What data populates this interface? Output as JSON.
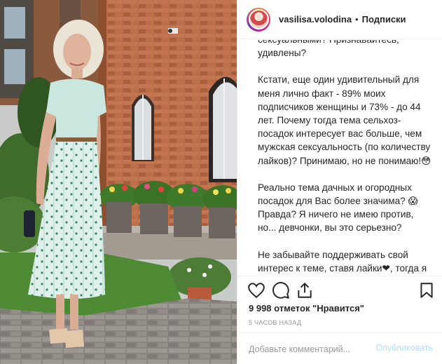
{
  "header": {
    "username": "vasilisa.volodina",
    "separator": "•",
    "follow_label": "Подписки"
  },
  "caption": {
    "lines_top": [
      "сексуальными? Признавайтесь,",
      "удивлены?"
    ],
    "paragraph_2": "Кстати, еще один удивительный для меня лично факт - 89% моих подписчиков женщины и 73% - до 44 лет. Почему тогда тема сельхоз-посадок интересует вас больше, чем мужская сексуальность (по количеству лайков)? Принимаю, но не понимаю!😳",
    "paragraph_3": "Реально тема дачных и огородных посадок для Вас более значима? 😱 Правда? Я ничего не имею против, но... девчонки, вы это серьезно?",
    "paragraph_4": "Не забывайте поддерживать свой интерес к теме, ставя лайки❤, тогда я продолжу раскрывать секреты «сексименов». О картошке писать летом нереально скучно, да и"
  },
  "actions": {
    "like_icon": "heart-icon",
    "comment_icon": "comment-icon",
    "share_icon": "share-icon",
    "save_icon": "bookmark-icon"
  },
  "likes_text": "9 998 отметок \"Нравится\"",
  "time_text": "5 ЧАСОВ НАЗАД",
  "comment": {
    "placeholder": "Добавьте комментарий...",
    "post_label": "Опубликовать"
  },
  "colors": {
    "brick": "#b56a45",
    "dress_top": "#c9e6df",
    "post_disabled": "#b2dffc"
  }
}
